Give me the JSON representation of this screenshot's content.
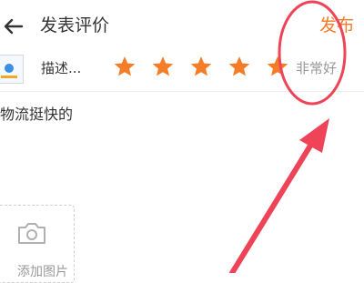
{
  "header": {
    "back_icon": "arrow-left-icon",
    "title": "发表评价",
    "publish_label": "发布"
  },
  "rating": {
    "label": "描述...",
    "stars_filled": 5,
    "stars_total": 5,
    "text": "非常好"
  },
  "comment": {
    "text": "物流挺快的"
  },
  "photo": {
    "icon": "camera-icon",
    "label": "添加图片"
  },
  "annotation": {
    "type": "red ellipse and arrow highlighting publish button"
  },
  "colors": {
    "accent": "#f57d29",
    "star": "#f57d29",
    "muted": "#999999",
    "annotation": "#ef4458"
  }
}
